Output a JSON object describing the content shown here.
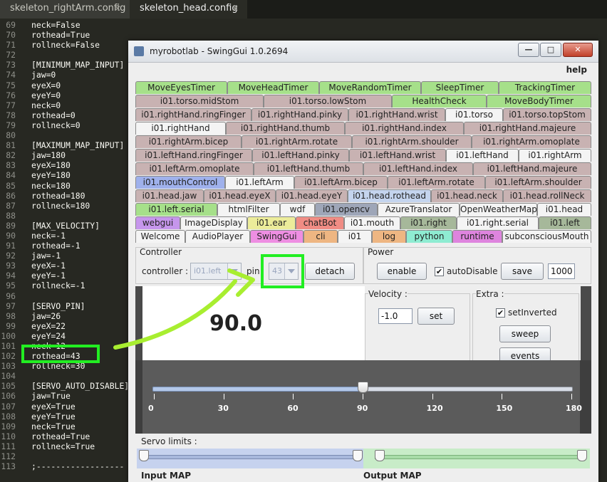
{
  "editor": {
    "tabs": [
      {
        "label": "skeleton_rightArm.config",
        "close": "✕"
      },
      {
        "label": "skeleton_head.config",
        "close": "✕"
      }
    ],
    "lines": [
      {
        "n": "69",
        "t": "neck=False"
      },
      {
        "n": "70",
        "t": "rothead=True"
      },
      {
        "n": "71",
        "t": "rollneck=False"
      },
      {
        "n": "72",
        "t": ""
      },
      {
        "n": "73",
        "t": "[MINIMUM_MAP_INPUT]"
      },
      {
        "n": "74",
        "t": "jaw=0"
      },
      {
        "n": "75",
        "t": "eyeX=0"
      },
      {
        "n": "76",
        "t": "eyeY=0"
      },
      {
        "n": "77",
        "t": "neck=0"
      },
      {
        "n": "78",
        "t": "rothead=0"
      },
      {
        "n": "79",
        "t": "rollneck=0"
      },
      {
        "n": "80",
        "t": ""
      },
      {
        "n": "81",
        "t": "[MAXIMUM_MAP_INPUT]"
      },
      {
        "n": "82",
        "t": "jaw=180"
      },
      {
        "n": "83",
        "t": "eyeX=180"
      },
      {
        "n": "84",
        "t": "eyeY=180"
      },
      {
        "n": "85",
        "t": "neck=180"
      },
      {
        "n": "86",
        "t": "rothead=180"
      },
      {
        "n": "87",
        "t": "rollneck=180"
      },
      {
        "n": "88",
        "t": ""
      },
      {
        "n": "89",
        "t": "[MAX_VELOCITY]"
      },
      {
        "n": "90",
        "t": "neck=-1"
      },
      {
        "n": "91",
        "t": "rothead=-1"
      },
      {
        "n": "92",
        "t": "jaw=-1"
      },
      {
        "n": "93",
        "t": "eyeX=-1"
      },
      {
        "n": "94",
        "t": "eyeY=-1"
      },
      {
        "n": "95",
        "t": "rollneck=-1"
      },
      {
        "n": "96",
        "t": ""
      },
      {
        "n": "97",
        "t": "[SERVO_PIN]"
      },
      {
        "n": "98",
        "t": "jaw=26"
      },
      {
        "n": "99",
        "t": "eyeX=22"
      },
      {
        "n": "100",
        "t": "eyeY=24"
      },
      {
        "n": "101",
        "t": "neck=12"
      },
      {
        "n": "102",
        "t": "rothead=43"
      },
      {
        "n": "103",
        "t": "rollneck=30"
      },
      {
        "n": "104",
        "t": ""
      },
      {
        "n": "105",
        "t": "[SERVO_AUTO_DISABLE]"
      },
      {
        "n": "106",
        "t": "jaw=True"
      },
      {
        "n": "107",
        "t": "eyeX=True"
      },
      {
        "n": "108",
        "t": "eyeY=True"
      },
      {
        "n": "109",
        "t": "neck=True"
      },
      {
        "n": "110",
        "t": "rothead=True"
      },
      {
        "n": "111",
        "t": "rollneck=True"
      },
      {
        "n": "112",
        "t": ""
      },
      {
        "n": "113",
        "t": ";------------------"
      }
    ]
  },
  "window": {
    "title": "myrobotlab - SwingGui 1.0.2694",
    "help": "help",
    "buttons": {
      "min": "—",
      "max": "□",
      "close": "✕"
    }
  },
  "tabs": [
    [
      {
        "l": "MoveEyesTimer",
        "c": "g"
      },
      {
        "l": "MoveHeadTimer",
        "c": "g"
      },
      {
        "l": "MoveRandomTimer",
        "c": "g"
      },
      {
        "l": "SleepTimer",
        "c": "g"
      },
      {
        "l": "TrackingTimer",
        "c": "g"
      }
    ],
    [
      {
        "l": "i01.torso.midStom",
        "c": ""
      },
      {
        "l": "i01.torso.lowStom",
        "c": ""
      },
      {
        "l": "HealthCheck",
        "c": "g"
      },
      {
        "l": "MoveBodyTimer",
        "c": "g"
      }
    ],
    [
      {
        "l": "i01.rightHand.ringFinger",
        "c": ""
      },
      {
        "l": "i01.rightHand.pinky",
        "c": ""
      },
      {
        "l": "i01.rightHand.wrist",
        "c": ""
      },
      {
        "l": "i01.torso",
        "c": "w"
      },
      {
        "l": "i01.torso.topStom",
        "c": ""
      }
    ],
    [
      {
        "l": "i01.rightHand",
        "c": "w"
      },
      {
        "l": "i01.rightHand.thumb",
        "c": ""
      },
      {
        "l": "i01.rightHand.index",
        "c": ""
      },
      {
        "l": "i01.rightHand.majeure",
        "c": ""
      }
    ],
    [
      {
        "l": "i01.rightArm.bicep",
        "c": ""
      },
      {
        "l": "i01.rightArm.rotate",
        "c": ""
      },
      {
        "l": "i01.rightArm.shoulder",
        "c": ""
      },
      {
        "l": "i01.rightArm.omoplate",
        "c": ""
      }
    ],
    [
      {
        "l": "i01.leftHand.ringFinger",
        "c": ""
      },
      {
        "l": "i01.leftHand.pinky",
        "c": ""
      },
      {
        "l": "i01.leftHand.wrist",
        "c": ""
      },
      {
        "l": "i01.leftHand",
        "c": "w"
      },
      {
        "l": "i01.rightArm",
        "c": "w"
      }
    ],
    [
      {
        "l": "i01.leftArm.omoplate",
        "c": ""
      },
      {
        "l": "i01.leftHand.thumb",
        "c": ""
      },
      {
        "l": "i01.leftHand.index",
        "c": ""
      },
      {
        "l": "i01.leftHand.majeure",
        "c": ""
      }
    ],
    [
      {
        "l": "i01.mouthControl",
        "c": "b"
      },
      {
        "l": "i01.leftArm",
        "c": "w"
      },
      {
        "l": "i01.leftArm.bicep",
        "c": ""
      },
      {
        "l": "i01.leftArm.rotate",
        "c": ""
      },
      {
        "l": "i01.leftArm.shoulder",
        "c": ""
      }
    ],
    [
      {
        "l": "i01.head.jaw",
        "c": ""
      },
      {
        "l": "i01.head.eyeX",
        "c": ""
      },
      {
        "l": "i01.head.eyeY",
        "c": ""
      },
      {
        "l": "i01.head.rothead",
        "c": "lb"
      },
      {
        "l": "i01.head.neck",
        "c": ""
      },
      {
        "l": "i01.head.rollNeck",
        "c": ""
      }
    ],
    [
      {
        "l": "i01.left.serial",
        "c": "g"
      },
      {
        "l": "htmlFilter",
        "c": "w"
      },
      {
        "l": "wdf",
        "c": "w"
      },
      {
        "l": "i01.opencv",
        "c": "gr"
      },
      {
        "l": "AzureTranslator",
        "c": "w"
      },
      {
        "l": "OpenWeatherMap",
        "c": "w"
      },
      {
        "l": "i01.head",
        "c": "w"
      }
    ],
    [
      {
        "l": "webgui",
        "c": "p"
      },
      {
        "l": "ImageDisplay",
        "c": "w"
      },
      {
        "l": "i01.ear",
        "c": "y"
      },
      {
        "l": "chatBot",
        "c": "r"
      },
      {
        "l": "i01.mouth",
        "c": "w"
      },
      {
        "l": "i01.right",
        "c": "og"
      },
      {
        "l": "i01.right.serial",
        "c": "w"
      },
      {
        "l": "i01.left",
        "c": "og"
      }
    ],
    [
      {
        "l": "Welcome",
        "c": "w"
      },
      {
        "l": "AudioPlayer",
        "c": "w"
      },
      {
        "l": "SwingGui",
        "c": "pk"
      },
      {
        "l": "cli",
        "c": "o"
      },
      {
        "l": "i01",
        "c": "w"
      },
      {
        "l": "log",
        "c": "o"
      },
      {
        "l": "python",
        "c": "c"
      },
      {
        "l": "runtime",
        "c": "m"
      },
      {
        "l": "subconsciousMouth",
        "c": "w"
      }
    ]
  ],
  "controller": {
    "title": "Controller",
    "controller_label": "controller :",
    "controller_value": "i01.left",
    "pin_label": "pin",
    "pin_value": "43",
    "detach": "detach"
  },
  "power": {
    "title": "Power",
    "enable": "enable",
    "auto_disable": "autoDisable",
    "auto_checked": "✔",
    "save": "save",
    "value": "1000"
  },
  "position": {
    "value": "90.0",
    "gauge": "40",
    "gauge_side": "1",
    "gauge_right": "-1"
  },
  "velocity": {
    "title": "Velocity :",
    "value": "-1.0",
    "set": "set"
  },
  "extra": {
    "title": "Extra :",
    "inverted": "setInverted",
    "inverted_checked": "✔",
    "sweep": "sweep",
    "events": "events"
  },
  "slider": {
    "value": 90,
    "min": 0,
    "max": 180,
    "ticks": [
      "0",
      "30",
      "60",
      "90",
      "120",
      "150",
      "180"
    ]
  },
  "limits": {
    "title": "Servo limits :",
    "input": "Input MAP",
    "output": "Output MAP"
  },
  "colors": {
    "highlight": "#22ee22"
  }
}
